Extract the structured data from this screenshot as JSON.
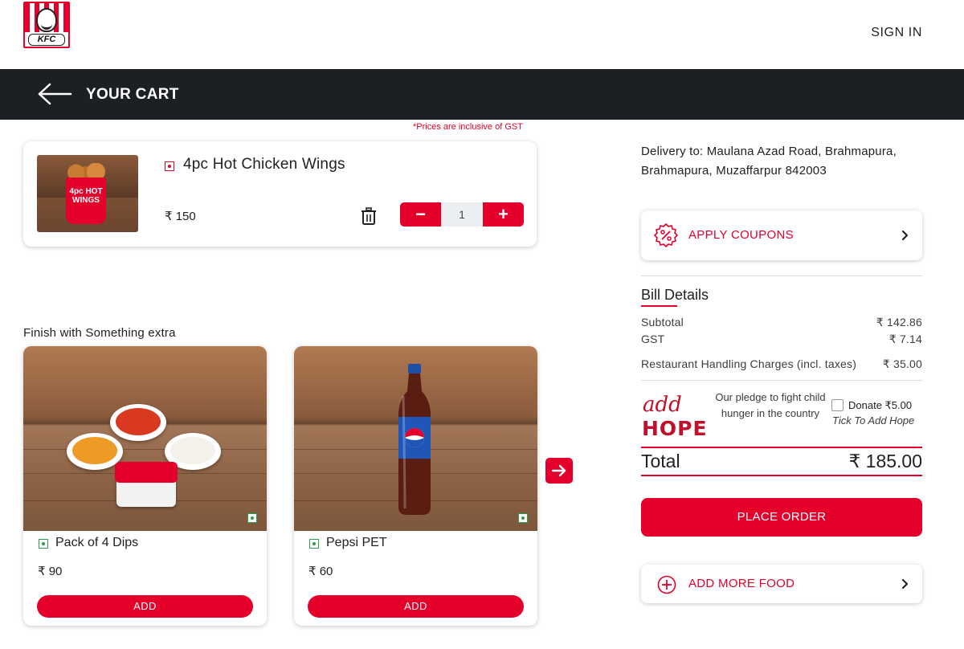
{
  "header": {
    "brand": "KFC",
    "signin_label": "SIGN IN"
  },
  "cart_bar": {
    "title": "YOUR CART"
  },
  "gst_note": "*Prices are inclusive of GST",
  "cart_item": {
    "name": "4pc Hot Chicken Wings",
    "price": "₹ 150",
    "quantity": "1",
    "decrement_symbol": "−",
    "increment_symbol": "+",
    "image_text": "4pc HOT WINGS"
  },
  "extras": {
    "title": "Finish with Something extra",
    "items": [
      {
        "name": "Pack of 4 Dips",
        "price": "₹ 90",
        "add_label": "ADD"
      },
      {
        "name": "Pepsi PET",
        "price": "₹ 60",
        "add_label": "ADD"
      }
    ]
  },
  "delivery": {
    "text": "Delivery to: Maulana Azad Road, Brahmapura, Brahmapura, Muzaffarpur 842003"
  },
  "coupons": {
    "label": "APPLY COUPONS"
  },
  "bill": {
    "title": "Bill Details",
    "rows": [
      {
        "label": "Subtotal",
        "value": "₹ 142.86"
      },
      {
        "label": "GST",
        "value": "₹ 7.14"
      },
      {
        "label": "Restaurant Handling Charges (incl. taxes)",
        "value": "₹ 35.00"
      }
    ]
  },
  "add_hope": {
    "logo_line1": "add",
    "logo_line2": "HOPE",
    "pledge": "Our pledge to fight child hunger in the country",
    "donate_label": "Donate ₹5.00",
    "tick_label": "Tick To Add Hope"
  },
  "total": {
    "label": "Total",
    "value": "₹ 185.00"
  },
  "place_order_label": "PLACE ORDER",
  "add_more_label": "ADD MORE FOOD",
  "colors": {
    "brand_red": "#e4002b",
    "header_dark": "#1c1f24",
    "veg_green": "#2e9e4a"
  }
}
